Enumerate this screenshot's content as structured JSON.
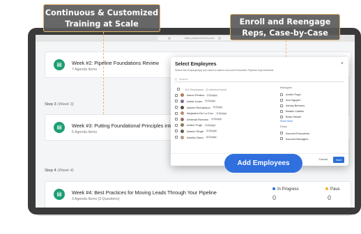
{
  "callouts": {
    "left_line1": "Continuous & Customized",
    "left_line2": "Training at Scale",
    "right_line1": "Enroll and Reengage",
    "right_line2": "Reps, Case-by-Case"
  },
  "browser": {
    "url": "https://www.entinity.com"
  },
  "week2": {
    "title": "Week #2: Pipeline Foundations Review",
    "subtitle": "7 Agenda Items"
  },
  "step3": {
    "label": "Step 3",
    "detail": "(Week 3)"
  },
  "week3": {
    "title": "Week #3: Putting Foundational Principles into P",
    "subtitle": "5 Agenda Items"
  },
  "step4": {
    "label": "Step 4",
    "detail": "(Week 4)"
  },
  "week4": {
    "title": "Week #4: Best Practices for Moving Leads Through Your Pipeline",
    "subtitle": "3 Agenda Items (3 Questions)"
  },
  "stats": [
    {
      "label": "In Progress",
      "value": "0",
      "color": "#2b6fd6"
    },
    {
      "label": "Paus",
      "value": "0",
      "color": "#f0b429"
    }
  ],
  "modal": {
    "title": "Select Employees",
    "description": "Select the Employee(s) you want to add to Account Executive Pipeline Improvement.",
    "search_placeholder": "Search",
    "close": "×",
    "header_count": "114 Employees",
    "header_selected": "(3 selected total)",
    "employees": [
      {
        "name": "Aaron Peraha",
        "groups": "4 Groups"
      },
      {
        "name": "Adela Jones",
        "groups": "3 Groups"
      },
      {
        "name": "Akeem Richardson",
        "groups": "5 Group"
      },
      {
        "name": "Alejandra De La Cruz",
        "groups": "3 Groups"
      },
      {
        "name": "Amanda Romano",
        "groups": "4 Groups"
      },
      {
        "name": "Amber Pugh",
        "groups": "4 Groups"
      },
      {
        "name": "Ameen Singh",
        "groups": "4 Groups"
      },
      {
        "name": "Amelia Olsen",
        "groups": "8 Groups"
      }
    ],
    "managers_heading": "Managers",
    "managers": [
      "Amber Pugh",
      "Ann Nguyen",
      "Ashley Behrens",
      "Beatriz Castillo",
      "Beau Hessel"
    ],
    "show_more": "Show More",
    "roles_heading": "Roles",
    "roles": [
      "Account Executives",
      "Account Managers"
    ],
    "cancel": "Cancel",
    "next": "Next"
  },
  "add_employees": "Add Employees"
}
